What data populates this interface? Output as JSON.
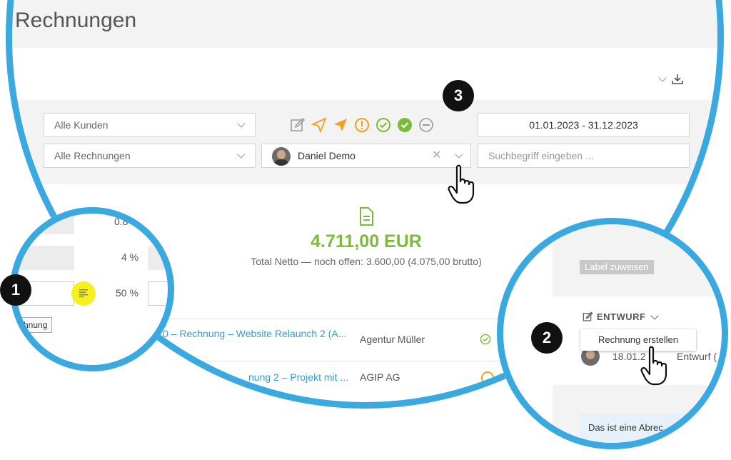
{
  "page": {
    "title": "Rechnungen"
  },
  "filters": {
    "customers": "Alle Kunden",
    "invoices": "Alle Rechnungen",
    "user": "Daniel Demo",
    "date_range": "01.01.2023 - 31.12.2023",
    "search_placeholder": "Suchbegriff eingeben ..."
  },
  "status_icons": [
    "edit-icon",
    "send-icon",
    "sent-icon",
    "warning-icon",
    "check-circle-icon",
    "check-filled-icon",
    "minus-circle-icon"
  ],
  "summary": {
    "amount": "4.711,00 EUR",
    "subtitle": "Total Netto — noch offen: 3.600,00 (4.075,00 brutto)"
  },
  "rows": [
    {
      "title": "0 – Rechnung – Website Relaunch 2 (A...",
      "customer": "Agentur Müller"
    },
    {
      "title": "nung 2 – Projekt mit ...",
      "customer": "AGIP AG"
    }
  ],
  "callouts": {
    "badge1": "1",
    "badge2": "2",
    "badge3": "3",
    "zoom1": {
      "v1": "0.8",
      "v2": "4 %",
      "v3": "50 %",
      "button": "chnung"
    },
    "zoom2": {
      "label_button": "Label zuweisen",
      "status": "ENTWURF",
      "menu_item": "Rechnung erstellen",
      "date": "18.01.2",
      "status_text": "Entwurf (",
      "note": "Das ist eine Abrec"
    }
  },
  "colors": {
    "ring": "#3aa9e0",
    "green": "#7cbb3a",
    "orange": "#f0a21c",
    "link": "#2f9fd8"
  }
}
